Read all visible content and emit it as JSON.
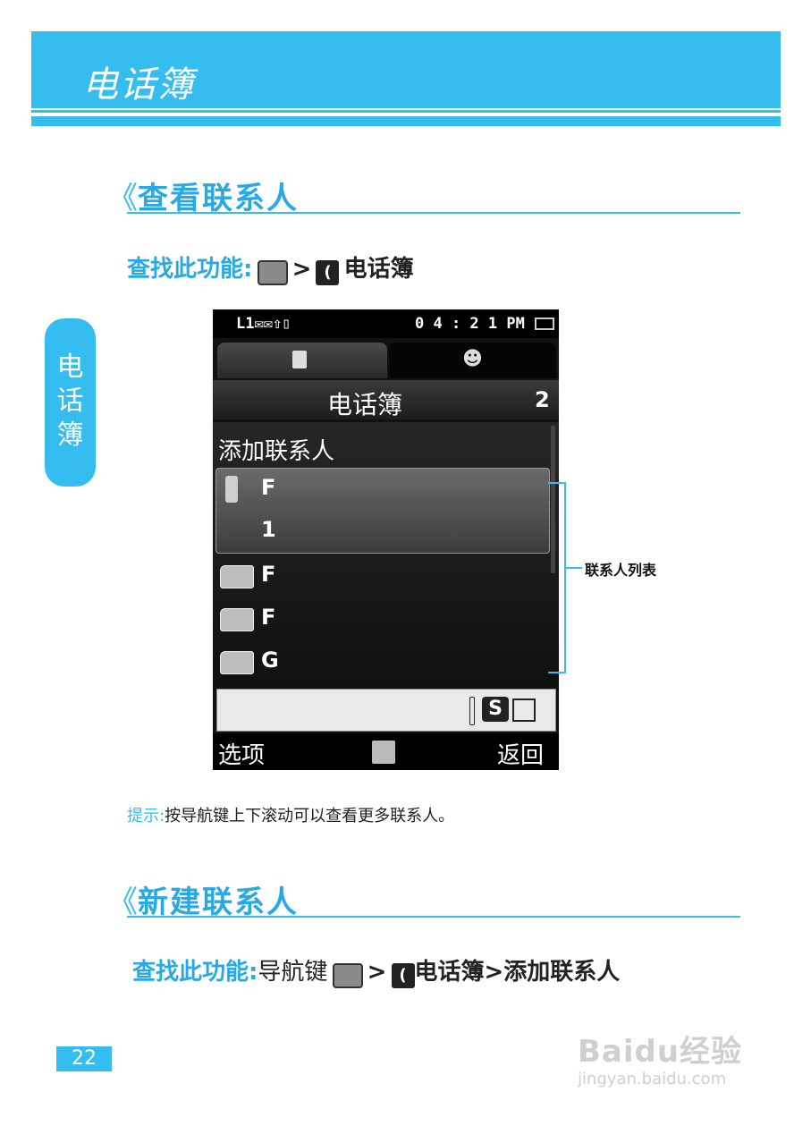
{
  "header": {
    "title": "电话簿"
  },
  "side_tab": {
    "label": "电话簿"
  },
  "section1": {
    "chevron": "《",
    "title": "查看联系人",
    "find_label": "查找此功能:",
    "find_arrow": ">",
    "find_target": "电话簿"
  },
  "phone": {
    "status_left": "L1✉✉⇧▯",
    "clock": "0 4 : 2 1 PM",
    "title": "电话簿",
    "count": "2",
    "add_contact": "添加联系人",
    "contacts": [
      {
        "name": "F",
        "icon": "mobile-phone-icon"
      },
      {
        "name": "1",
        "icon": ""
      },
      {
        "name": "F",
        "icon": "contact-card-icon"
      },
      {
        "name": "F",
        "icon": "contact-card-icon"
      },
      {
        "name": "G",
        "icon": "contact-card-icon"
      }
    ],
    "input_icons": "S",
    "softkey_left": "选项",
    "softkey_right": "返回"
  },
  "callout": {
    "label": "联系人列表"
  },
  "tip": {
    "label": "提示:",
    "text": "按导航键上下滚动可以查看更多联系人。"
  },
  "section2": {
    "chevron": "《",
    "title": "新建联系人",
    "find_label": "查找此功能:",
    "find_prefix": "导航键",
    "find_arrow": ">",
    "find_target": "电话簿>添加联系人"
  },
  "page_number": "22",
  "watermark": {
    "brand": "Baidu经验",
    "url": "jingyan.baidu.com"
  },
  "colors": {
    "accent": "#35bdf0"
  }
}
